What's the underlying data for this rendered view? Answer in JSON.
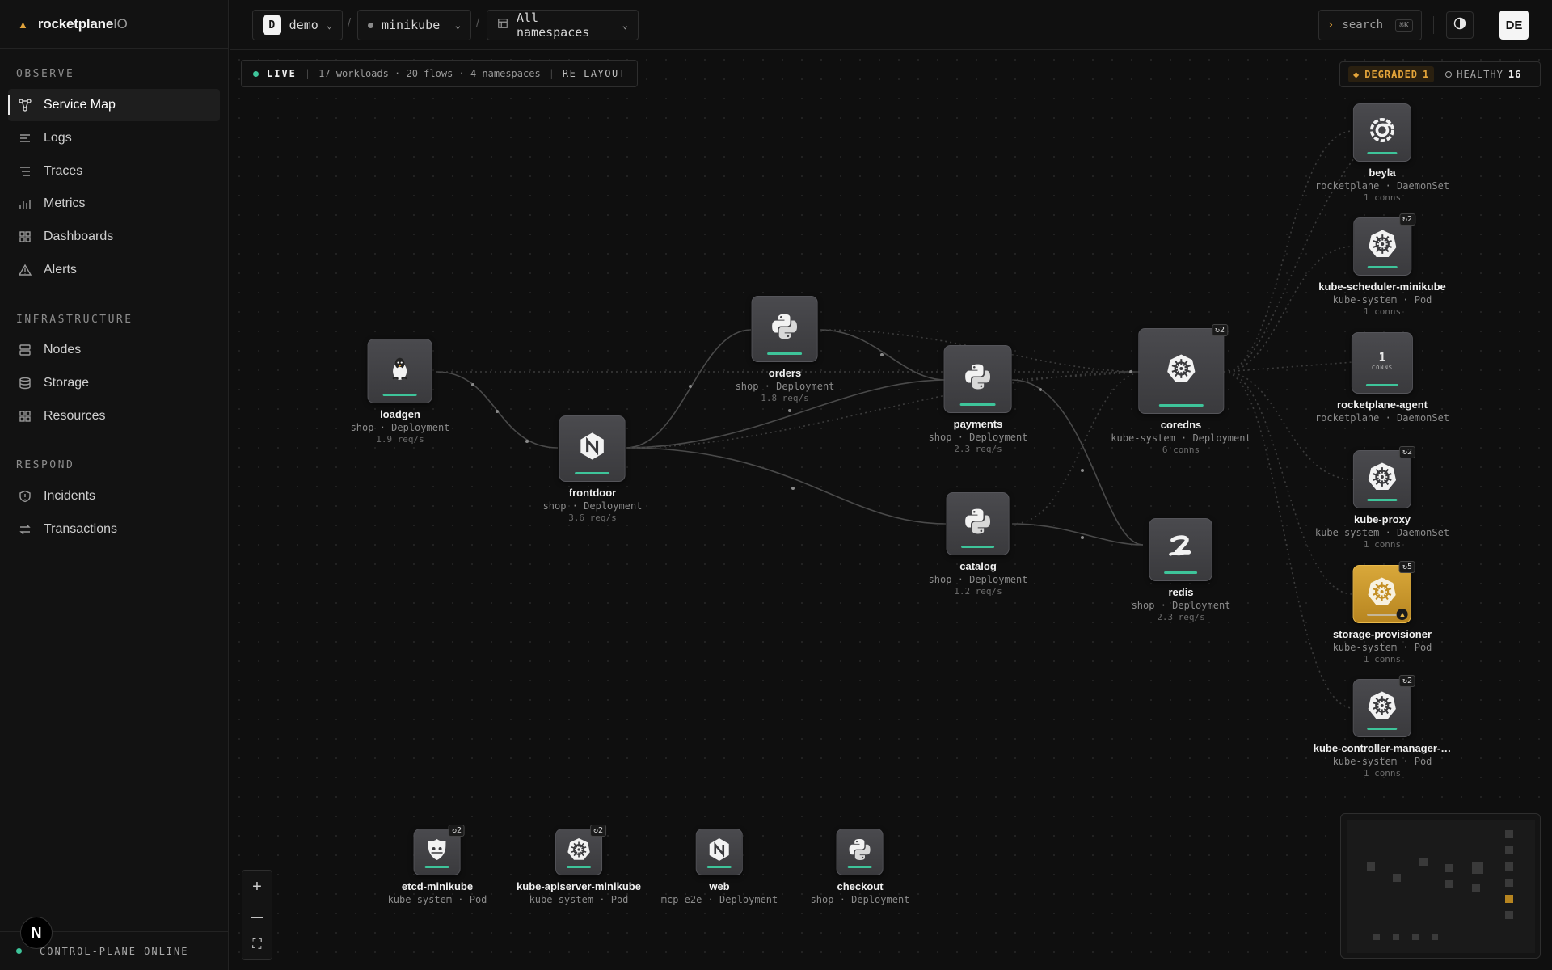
{
  "brand": {
    "name": "rocketplane",
    "suffix": "IO"
  },
  "sidebar": {
    "sections": [
      {
        "label": "OBSERVE",
        "items": [
          {
            "label": "Service Map",
            "icon": "service-map-icon",
            "active": true
          },
          {
            "label": "Logs",
            "icon": "logs-icon"
          },
          {
            "label": "Traces",
            "icon": "traces-icon"
          },
          {
            "label": "Metrics",
            "icon": "metrics-icon"
          },
          {
            "label": "Dashboards",
            "icon": "dashboards-icon"
          },
          {
            "label": "Alerts",
            "icon": "alert-triangle-icon"
          }
        ]
      },
      {
        "label": "INFRASTRUCTURE",
        "items": [
          {
            "label": "Nodes",
            "icon": "server-icon"
          },
          {
            "label": "Storage",
            "icon": "database-icon"
          },
          {
            "label": "Resources",
            "icon": "grid-icon"
          }
        ]
      },
      {
        "label": "RESPOND",
        "items": [
          {
            "label": "Incidents",
            "icon": "shield-icon"
          },
          {
            "label": "Transactions",
            "icon": "swap-icon"
          }
        ]
      }
    ],
    "footer": "CONTROL-PLANE ONLINE",
    "badge": "N"
  },
  "topbar": {
    "org": {
      "avatar": "D",
      "label": "demo"
    },
    "cluster": {
      "label": "minikube"
    },
    "namespace": {
      "label": "All namespaces"
    },
    "separator": "/",
    "search": {
      "prompt": "›",
      "label": "search",
      "kbd": "⌘K"
    },
    "user": "DE"
  },
  "status": {
    "live": "LIVE",
    "summary": "17 workloads · 20 flows · 4 namespaces",
    "relayout": "RE-LAYOUT",
    "degraded_label": "DEGRADED",
    "degraded_count": "1",
    "healthy_label": "HEALTHY",
    "healthy_count": "16"
  },
  "nodes": [
    {
      "id": "loadgen",
      "name": "loadgen",
      "meta": "shop · Deployment",
      "rate": "1.9 req/s",
      "icon": "linux-icon"
    },
    {
      "id": "frontdoor",
      "name": "frontdoor",
      "meta": "shop · Deployment",
      "rate": "3.6 req/s",
      "icon": "nginx-icon"
    },
    {
      "id": "orders",
      "name": "orders",
      "meta": "shop · Deployment",
      "rate": "1.8 req/s",
      "icon": "python-icon"
    },
    {
      "id": "payments",
      "name": "payments",
      "meta": "shop · Deployment",
      "rate": "2.3 req/s",
      "icon": "python-icon"
    },
    {
      "id": "catalog",
      "name": "catalog",
      "meta": "shop · Deployment",
      "rate": "1.2 req/s",
      "icon": "python-icon"
    },
    {
      "id": "coredns",
      "name": "coredns",
      "meta": "kube-system · Deployment",
      "rate": "6 conns",
      "icon": "kubernetes-icon",
      "restarts": "↻2"
    },
    {
      "id": "redis",
      "name": "redis",
      "meta": "shop · Deployment",
      "rate": "2.3 req/s",
      "icon": "redis-icon"
    },
    {
      "id": "beyla",
      "name": "beyla",
      "meta": "rocketplane · DaemonSet",
      "rate": "1 conns",
      "icon": "grafana-icon"
    },
    {
      "id": "kube-scheduler",
      "name": "kube-scheduler-minikube",
      "meta": "kube-system · Pod",
      "rate": "1 conns",
      "icon": "kubernetes-icon",
      "restarts": "↻2"
    },
    {
      "id": "rocketplane-agent",
      "name": "rocketplane-agent",
      "meta": "rocketplane · DaemonSet",
      "rate": "",
      "icon": "conns-icon",
      "conns_num": "1",
      "conns_lbl": "CONNS"
    },
    {
      "id": "kube-proxy",
      "name": "kube-proxy",
      "meta": "kube-system · DaemonSet",
      "rate": "1 conns",
      "icon": "kubernetes-icon",
      "restarts": "↻2"
    },
    {
      "id": "storage-provisioner",
      "name": "storage-provisioner",
      "meta": "kube-system · Pod",
      "rate": "1 conns",
      "icon": "kubernetes-icon",
      "restarts": "↻5",
      "warn": true
    },
    {
      "id": "kube-controller",
      "name": "kube-controller-manager-…",
      "meta": "kube-system · Pod",
      "rate": "1 conns",
      "icon": "kubernetes-icon",
      "restarts": "↻2"
    },
    {
      "id": "etcd",
      "name": "etcd-minikube",
      "meta": "kube-system · Pod",
      "rate": "",
      "icon": "etcd-icon",
      "restarts": "↻2"
    },
    {
      "id": "kube-apiserver",
      "name": "kube-apiserver-minikube",
      "meta": "kube-system · Pod",
      "rate": "",
      "icon": "kubernetes-icon",
      "restarts": "↻2"
    },
    {
      "id": "web",
      "name": "web",
      "meta": "mcp-e2e · Deployment",
      "rate": "",
      "icon": "nginx-icon"
    },
    {
      "id": "checkout",
      "name": "checkout",
      "meta": "shop · Deployment",
      "rate": "",
      "icon": "python-icon"
    }
  ],
  "zoom": {
    "in": "+",
    "out": "—",
    "fit": "⛶"
  },
  "colors": {
    "accent": "#e0a23a",
    "healthy": "#3ec49a",
    "warn": "#d9a83a"
  }
}
